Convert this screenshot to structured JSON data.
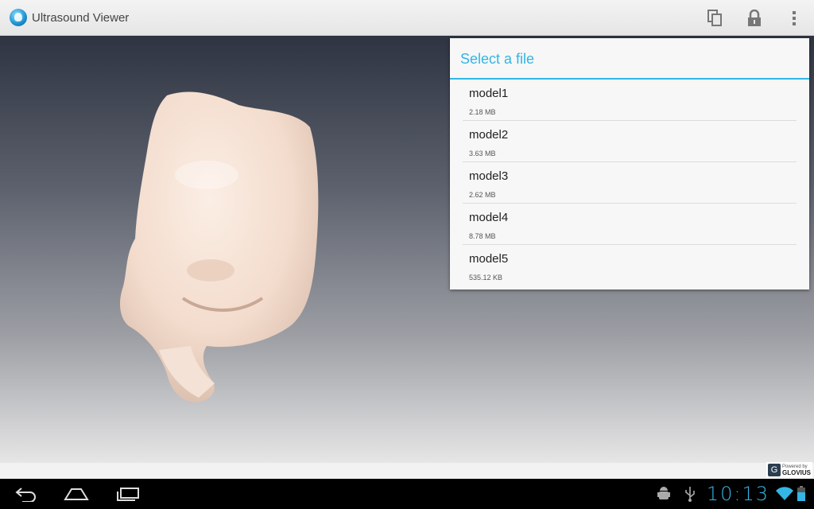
{
  "app": {
    "title": "Ultrasound Viewer"
  },
  "action_bar": {
    "icons": [
      "copy-icon",
      "lock-icon",
      "overflow-menu-icon"
    ]
  },
  "dialog": {
    "title": "Select a file",
    "files": [
      {
        "name": "model1",
        "size": "2.18 MB"
      },
      {
        "name": "model2",
        "size": "3.63 MB"
      },
      {
        "name": "model3",
        "size": "2.62 MB"
      },
      {
        "name": "model4",
        "size": "8.78 MB"
      },
      {
        "name": "model5",
        "size": "535.12 KB"
      }
    ]
  },
  "branding": {
    "powered_by": "Powered by",
    "company": "GLOVIUS",
    "logo_letter": "G"
  },
  "system_bar": {
    "time": "10:13",
    "nav_icons": [
      "back-icon",
      "home-icon",
      "recent-apps-icon"
    ],
    "status_icons": [
      "android-debug-icon",
      "usb-icon",
      "wifi-icon",
      "battery-icon"
    ]
  },
  "colors": {
    "accent": "#33b5e5",
    "model": "#f6e1d3"
  }
}
